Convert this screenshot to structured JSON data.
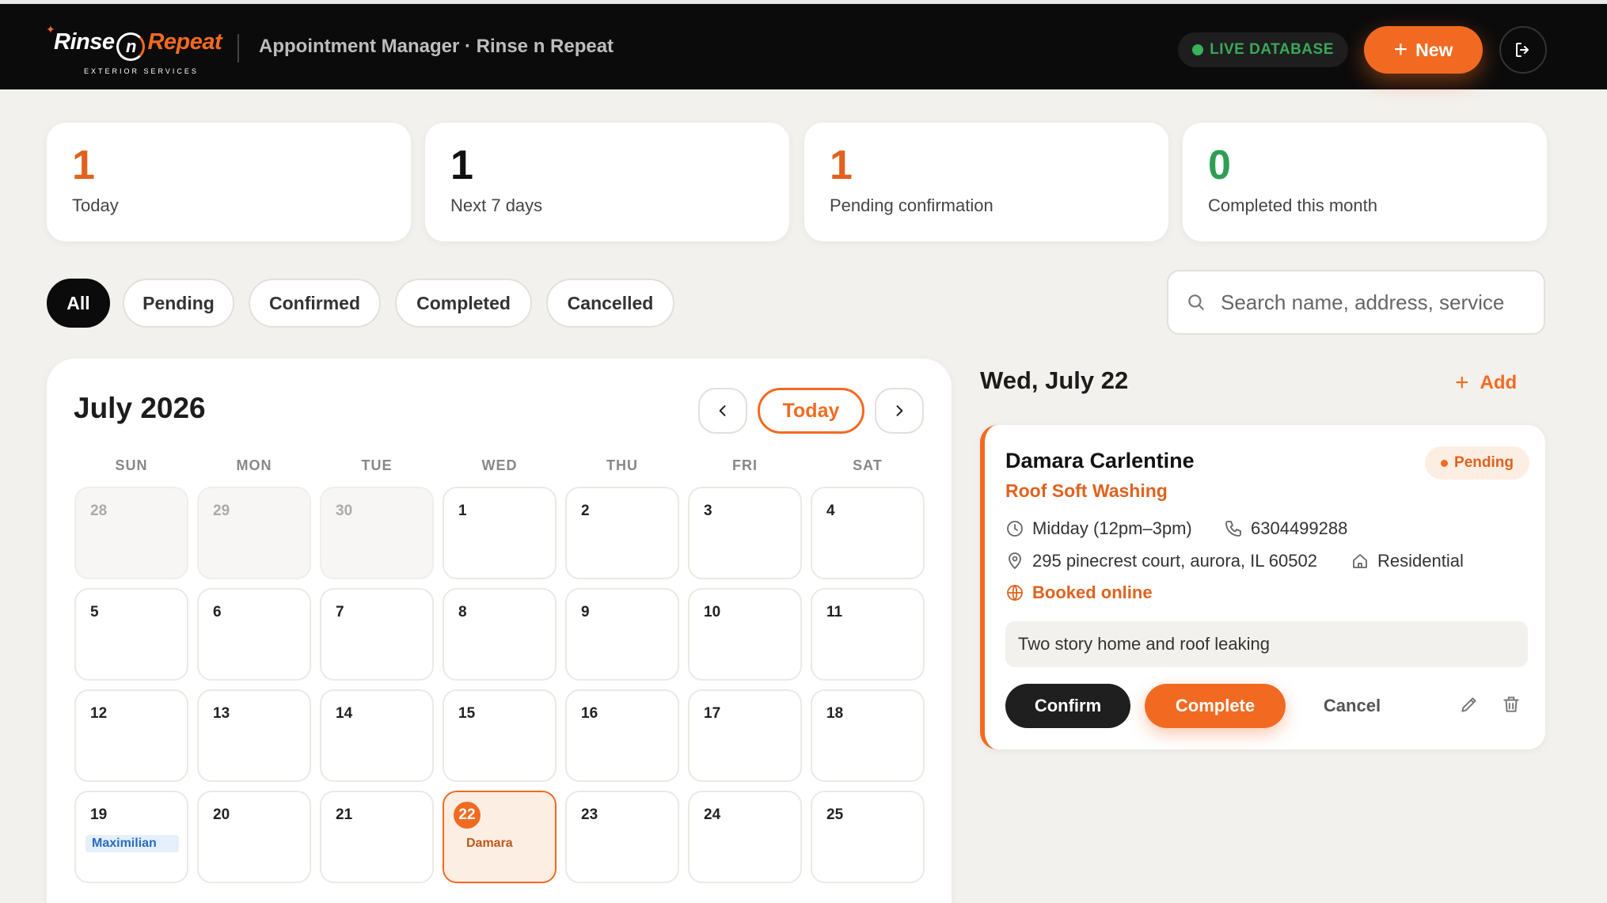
{
  "header": {
    "logo_main_a": "Rinse",
    "logo_main_n": "n",
    "logo_main_b": "Repeat",
    "logo_sub": "EXTERIOR SERVICES",
    "app_title": "Appointment Manager · Rinse n Repeat",
    "live_label": "LIVE DATABASE",
    "new_label": "New"
  },
  "stats": [
    {
      "value": "1",
      "label": "Today",
      "color": "#e0621e"
    },
    {
      "value": "1",
      "label": "Next 7 days",
      "color": "#111111"
    },
    {
      "value": "1",
      "label": "Pending confirmation",
      "color": "#e0621e"
    },
    {
      "value": "0",
      "label": "Completed this month",
      "color": "#2f9e55"
    }
  ],
  "filters": [
    "All",
    "Pending",
    "Confirmed",
    "Completed",
    "Cancelled"
  ],
  "search": {
    "placeholder": "Search name, address, service"
  },
  "calendar": {
    "title": "July 2026",
    "today_label": "Today",
    "weekdays": [
      "SUN",
      "MON",
      "TUE",
      "WED",
      "THU",
      "FRI",
      "SAT"
    ],
    "weeks": [
      [
        "28",
        "29",
        "30",
        "1",
        "2",
        "3",
        "4"
      ],
      [
        "5",
        "6",
        "7",
        "8",
        "9",
        "10",
        "11"
      ],
      [
        "12",
        "13",
        "14",
        "15",
        "16",
        "17",
        "18"
      ],
      [
        "19",
        "20",
        "21",
        "22",
        "23",
        "24",
        "25"
      ]
    ],
    "events": {
      "19": "Maximilian",
      "22": "Damara"
    }
  },
  "panel": {
    "date": "Wed, July 22",
    "add_label": "Add",
    "appointment": {
      "name": "Damara Carlentine",
      "service": "Roof Soft Washing",
      "status": "Pending",
      "time": "Midday (12pm–3pm)",
      "phone": "6304499288",
      "address": "295 pinecrest court, aurora, IL 60502",
      "property_type": "Residential",
      "source": "Booked online",
      "note": "Two story home and roof leaking",
      "confirm_label": "Confirm",
      "complete_label": "Complete",
      "cancel_label": "Cancel"
    }
  },
  "colors": {
    "accent": "#f26a21",
    "live": "#36b35a"
  }
}
